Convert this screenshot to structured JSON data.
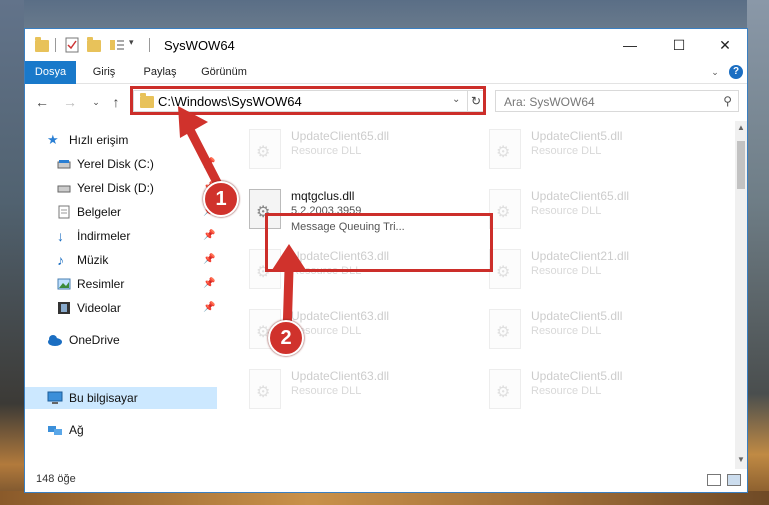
{
  "window": {
    "title": "SysWOW64",
    "controls": {
      "minimize": "—",
      "maximize": "☐",
      "close": "✕"
    }
  },
  "ribbon": {
    "tabs": [
      {
        "label": "Dosya",
        "active": true
      },
      {
        "label": "Giriş"
      },
      {
        "label": "Paylaş"
      },
      {
        "label": "Görünüm"
      }
    ],
    "help": "?"
  },
  "address": {
    "path": "C:\\Windows\\SysWOW64",
    "search_placeholder": "Ara: SysWOW64"
  },
  "sidebar": {
    "items": [
      {
        "label": "Hızlı erişim",
        "icon": "star-icon"
      },
      {
        "label": "Yerel Disk (C:)",
        "icon": "drive-icon",
        "pinned": true
      },
      {
        "label": "Yerel Disk (D:)",
        "icon": "drive-icon",
        "pinned": true
      },
      {
        "label": "Belgeler",
        "icon": "documents-icon",
        "pinned": true
      },
      {
        "label": "İndirmeler",
        "icon": "download-icon",
        "pinned": true
      },
      {
        "label": "Müzik",
        "icon": "music-icon",
        "pinned": true
      },
      {
        "label": "Resimler",
        "icon": "pictures-icon",
        "pinned": true
      },
      {
        "label": "Videolar",
        "icon": "videos-icon",
        "pinned": true
      },
      {
        "label": "OneDrive",
        "icon": "cloud-icon"
      },
      {
        "label": "Bu bilgisayar",
        "icon": "computer-icon",
        "selected": true
      },
      {
        "label": "Ağ",
        "icon": "network-icon"
      }
    ]
  },
  "files": {
    "items": [
      {
        "name": "UpdateClient65.dll",
        "type": "Resource DLL"
      },
      {
        "name": "UpdateClient5.dll",
        "type": "Resource DLL"
      },
      {
        "name": "mqtgclus.dll",
        "version": "5.2.2003.3959",
        "type": "Message Queuing Tri...",
        "selected": true
      },
      {
        "name": "UpdateClient65.dll",
        "type": "Resource DLL"
      },
      {
        "name": "UpdateClient63.dll",
        "type": "Resource DLL"
      },
      {
        "name": "UpdateClient21.dll",
        "type": "Resource DLL"
      },
      {
        "name": "UpdateClient63.dll",
        "type": "Resource DLL"
      },
      {
        "name": "UpdateClient5.dll",
        "type": "Resource DLL"
      },
      {
        "name": "UpdateClient63.dll",
        "type": "Resource DLL"
      },
      {
        "name": "UpdateClient5.dll",
        "type": "Resource DLL"
      }
    ]
  },
  "annotations": {
    "badge1": "1",
    "badge2": "2",
    "highlight_color": "#cc2e2a"
  },
  "status": {
    "item_count": "148 öğe"
  }
}
